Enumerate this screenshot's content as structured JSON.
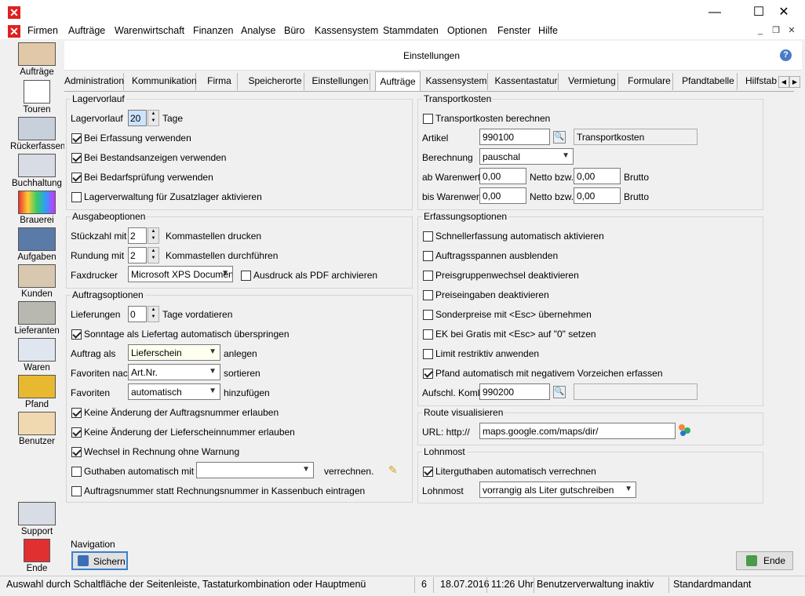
{
  "window": {
    "minimize": "—",
    "maximize": "☐",
    "close": "✕"
  },
  "menu": [
    "Firmen",
    "Aufträge",
    "Warenwirtschaft",
    "Finanzen",
    "Analyse",
    "Büro",
    "Kassensystem",
    "Stammdaten",
    "Optionen",
    "Fenster",
    "Hilfe"
  ],
  "sidebar": [
    "Aufträge",
    "Touren",
    "Rückerfassen",
    "Buchhaltung",
    "Brauerei",
    "Aufgaben",
    "Kunden",
    "Lieferanten",
    "Waren",
    "Pfand",
    "Benutzer",
    "Support",
    "Ende"
  ],
  "header": {
    "title": "Einstellungen",
    "help": "?"
  },
  "tabs": [
    "Administration",
    "Kommunikation",
    "Firma",
    "Speicherorte",
    "Einstellungen",
    "Aufträge",
    "Kassensystem",
    "Kassentastatur",
    "Vermietung",
    "Formulare",
    "Pfandtabelle",
    "Hilfstab"
  ],
  "lagerverlauf": {
    "title": "Lagervorlauf",
    "label": "Lagervorlauf",
    "value": "20",
    "unit": "Tage",
    "checks": [
      "Bei Erfassung verwenden",
      "Bei Bestandsanzeigen verwenden",
      "Bei Bedarfsprüfung verwenden",
      "Lagerverwaltung für Zusatzlager aktivieren"
    ]
  },
  "ausgabe": {
    "title": "Ausgabeoptionen",
    "stueck_label": "Stückzahl mit",
    "stueck_value": "2",
    "stueck_suffix": "Kommastellen drucken",
    "rund_label": "Rundung mit",
    "rund_value": "2",
    "rund_suffix": "Kommastellen durchführen",
    "fax_label": "Faxdrucker",
    "fax_value": "Microsoft XPS Documen",
    "pdf_label": "Ausdruck als PDF archivieren"
  },
  "auftrag": {
    "title": "Auftragsoptionen",
    "lief_label": "Lieferungen",
    "lief_value": "0",
    "lief_suffix": "Tage vordatieren",
    "sonntage": "Sonntage als Liefertag automatisch überspringen",
    "als_label": "Auftrag als",
    "als_value": "Lieferschein",
    "als_suffix": "anlegen",
    "fav_nach_label": "Favoriten nach",
    "fav_nach_value": "Art.Nr.",
    "fav_nach_suffix": "sortieren",
    "fav_label": "Favoriten",
    "fav_value": "automatisch",
    "fav_suffix": "hinzufügen",
    "checks": [
      "Keine Änderung der Auftragsnummer erlauben",
      "Keine Änderung der Lieferscheinnummer erlauben",
      "Wechsel in Rechnung ohne Warnung"
    ],
    "guthaben": "Guthaben automatisch mit",
    "verrechnen": "verrechnen.",
    "kassenbuch": "Auftragsnummer statt Rechnungsnummer in Kassenbuch eintragen"
  },
  "transport": {
    "title": "Transportkosten",
    "berechnen": "Transportkosten berechnen",
    "artikel_label": "Artikel",
    "artikel_value": "990100",
    "artikel_name": "Transportkosten",
    "berechnung_label": "Berechnung",
    "berechnung_value": "pauschal",
    "ab_label": "ab Warenwert",
    "ab_netto": "0,00",
    "netto_label": "Netto bzw.",
    "ab_brutto": "0,00",
    "brutto_label": "Brutto",
    "bis_label": "bis Warenwert",
    "bis_netto": "0,00",
    "bis_brutto": "0,00"
  },
  "erfassung": {
    "title": "Erfassungsoptionen",
    "checks": [
      "Schnellerfassung automatisch aktivieren",
      "Auftragsspannen ausblenden",
      "Preisgruppenwechsel deaktivieren",
      "Preiseingaben deaktivieren",
      "Sonderpreise mit <Esc> übernehmen",
      "EK bei Gratis mit <Esc> auf \"0\" setzen",
      "Limit restriktiv anwenden",
      "Pfand automatisch mit negativem Vorzeichen erfassen"
    ],
    "kombi_label": "Aufschl. Kombi",
    "kombi_value": "990200"
  },
  "route": {
    "title": "Route visualisieren",
    "url_label": "URL: http://",
    "url_value": "maps.google.com/maps/dir/"
  },
  "lohnmost": {
    "title": "Lohnmost",
    "check": "Literguthaben automatisch verrechnen",
    "label": "Lohnmost",
    "value": "vorrangig als Liter gutschreiben"
  },
  "nav": {
    "title": "Navigation",
    "save": "Sichern",
    "end": "Ende"
  },
  "status": {
    "hint": "Auswahl durch Schaltfläche der Seitenleiste, Tastaturkombination oder Hauptmenü",
    "num": "6",
    "date": "18.07.2016",
    "time": "11:26 Uhr",
    "users": "Benutzerverwaltung inaktiv",
    "mandant": "Standardmandant"
  }
}
